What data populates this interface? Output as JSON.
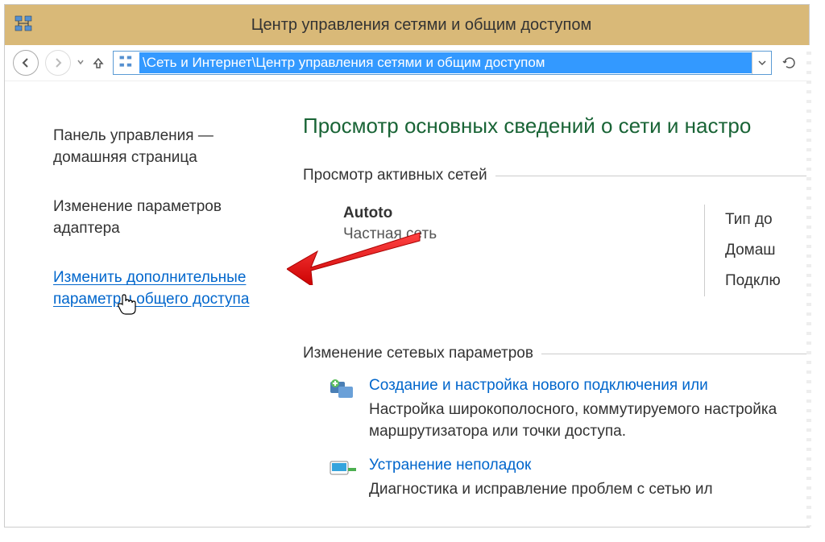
{
  "title": "Центр управления сетями и общим доступом",
  "address": "\\Сеть и Интернет\\Центр управления сетями и общим доступом",
  "sidebar": {
    "home": "Панель управления — домашняя страница",
    "adapter": "Изменение параметров адаптера",
    "advanced": "Изменить дополнительные параметры общего доступа"
  },
  "main": {
    "heading": "Просмотр основных сведений о сети и настро",
    "active_section": "Просмотр активных сетей",
    "network": {
      "name": "Autoto",
      "type": "Частная сеть",
      "access_label": "Тип до",
      "home_label": "Домаш",
      "conn_label": "Подклю"
    },
    "change_section": "Изменение сетевых параметров",
    "action1": {
      "link": "Создание и настройка нового подключения или ",
      "desc": "Настройка широкополосного, коммутируемого \nнастройка маршрутизатора или точки доступа."
    },
    "action2": {
      "link": "Устранение неполадок",
      "desc": "Диагностика и исправление проблем с сетью ил"
    }
  }
}
